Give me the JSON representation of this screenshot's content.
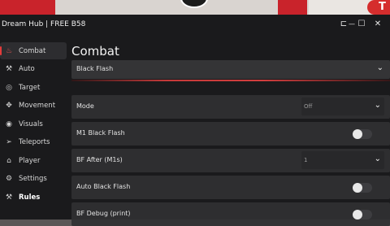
{
  "background": {
    "badge_text": "T"
  },
  "window": {
    "title": "Dream Hub  |  FREE  B58",
    "controls": {
      "layout_icon": "⊏",
      "minimize_icon": "—",
      "maximize_icon": "☐",
      "close_icon": "✕"
    }
  },
  "sidebar": {
    "items": [
      {
        "label": "Combat",
        "icon": "flame-icon",
        "glyph": "♨",
        "active": true
      },
      {
        "label": "Auto",
        "icon": "wand-icon",
        "glyph": "⚒"
      },
      {
        "label": "Target",
        "icon": "target-icon",
        "glyph": "◎"
      },
      {
        "label": "Movement",
        "icon": "move-icon",
        "glyph": "✥"
      },
      {
        "label": "Visuals",
        "icon": "eye-icon",
        "glyph": "◉"
      },
      {
        "label": "Teleports",
        "icon": "send-icon",
        "glyph": "➢"
      },
      {
        "label": "Player",
        "icon": "home-icon",
        "glyph": "⌂"
      },
      {
        "label": "Settings",
        "icon": "wrench-icon",
        "glyph": "⚙"
      },
      {
        "label": "Rules",
        "icon": "hammer-icon",
        "glyph": "⚒",
        "bold": true
      }
    ]
  },
  "main": {
    "section_title": "Combat",
    "dropdown_header": "Black Flash",
    "rows": {
      "mode": {
        "label": "Mode",
        "value": "Off"
      },
      "m1_black_flash": {
        "label": "M1 Black Flash",
        "on": false
      },
      "bf_after": {
        "label": "BF After (M1s)",
        "value": "1"
      },
      "auto_black_flash": {
        "label": "Auto Black Flash",
        "on": false
      },
      "bf_debug": {
        "label": "BF Debug (print)",
        "on": false
      }
    }
  },
  "colors": {
    "accent": "#d23e3e",
    "panel": "#303032",
    "window": "#161618"
  }
}
